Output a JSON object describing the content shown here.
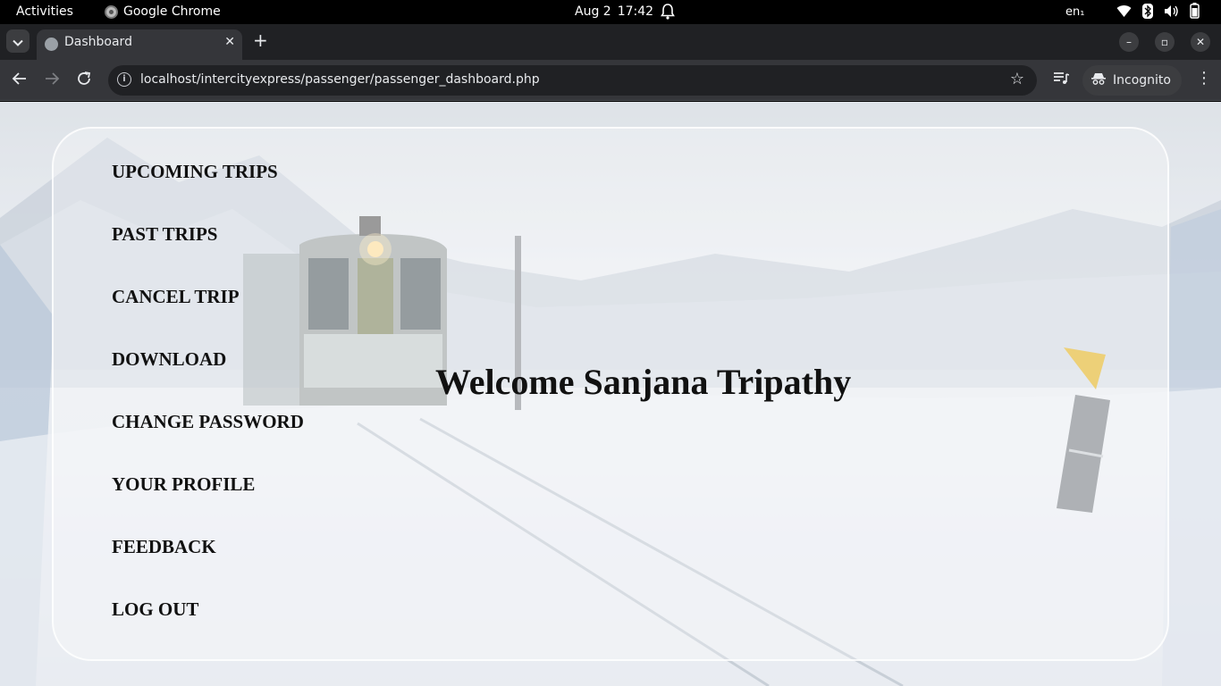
{
  "system_bar": {
    "activities": "Activities",
    "app_name": "Google Chrome",
    "date": "Aug 2",
    "time": "17:42",
    "language": "en₁"
  },
  "browser": {
    "tab_title": "Dashboard",
    "new_tab": "+",
    "url": "localhost/intercityexpress/passenger/passenger_dashboard.php",
    "profile_label": "Incognito"
  },
  "page": {
    "menu": [
      {
        "label": "UPCOMING TRIPS"
      },
      {
        "label": "PAST TRIPS"
      },
      {
        "label": "CANCEL TRIP"
      },
      {
        "label": "DOWNLOAD"
      },
      {
        "label": "CHANGE PASSWORD"
      },
      {
        "label": "YOUR PROFILE"
      },
      {
        "label": "FEEDBACK"
      },
      {
        "label": "LOG OUT"
      }
    ],
    "welcome": "Welcome Sanjana Tripathy"
  },
  "icons": [
    "chrome-icon",
    "bell-icon",
    "wifi-icon",
    "bluetooth-icon",
    "volume-icon",
    "battery-icon",
    "tab-search-icon",
    "globe-icon",
    "close-icon",
    "minimize-icon",
    "maximize-icon",
    "back-icon",
    "forward-icon",
    "reload-icon",
    "info-icon",
    "star-icon",
    "media-icon",
    "incognito-icon",
    "more-icon"
  ],
  "colors": {
    "menu_text": "#111111",
    "chrome_dark": "#202124",
    "chrome_toolbar": "#35363a"
  }
}
